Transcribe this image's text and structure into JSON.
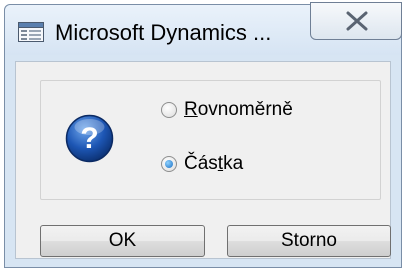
{
  "window": {
    "title": "Microsoft Dynamics ...",
    "close_icon": "close-x-icon",
    "app_icon": "dynamics-app-icon"
  },
  "dialog": {
    "question_icon": "question-icon",
    "options": [
      {
        "prefix": "",
        "mnemonic": "R",
        "suffix": "ovnoměrně",
        "checked": false
      },
      {
        "prefix": "Čás",
        "mnemonic": "t",
        "suffix": "ka",
        "checked": true
      }
    ],
    "ok_label": "OK",
    "cancel_label": "Storno"
  }
}
